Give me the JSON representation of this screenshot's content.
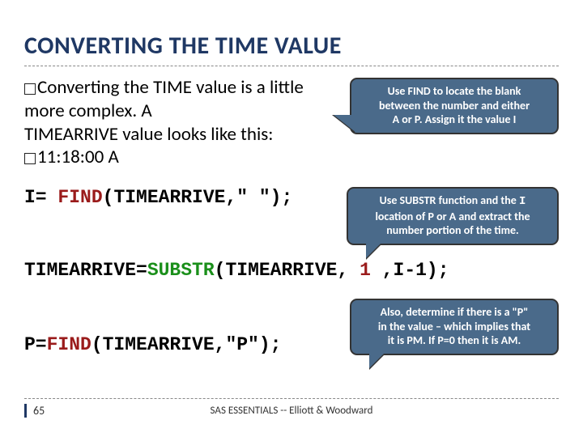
{
  "title": "CONVERTING THE TIME VALUE",
  "para": {
    "line1a": "Converting the TIME value is a little more complex. A",
    "line1b": "TIMEARRIVE value looks like this:",
    "line2": "11:18:00 A"
  },
  "callouts": {
    "c1a": "Use FIND to locate the blank",
    "c1b": "between the number and either",
    "c1c": "A or P. Assign it the value I",
    "c2a": "Use SUBSTR function and the ",
    "c2i": "I",
    "c2b": "location of P or A and extract the",
    "c2c": "number portion of the time.",
    "c3a": "Also, determine if there is a \"P\"",
    "c3b": "in the value – which implies that",
    "c3c": "it is PM. If P=0 then it is AM."
  },
  "code": {
    "l1_a": "I= ",
    "l1_b": "FIND",
    "l1_c": "(TIMEARRIVE,\" \");",
    "l2_a": "TIMEARRIVE=",
    "l2_b": "SUBSTR",
    "l2_c": "(TIMEARRIVE, ",
    "l2_d": "1",
    "l2_e": " ,I-1);",
    "l3_a": "P=",
    "l3_b": "FIND",
    "l3_c": "(TIMEARRIVE,\"P\");"
  },
  "footer": {
    "page": "65",
    "credit": "SAS ESSENTIALS -- Elliott & Woodward"
  }
}
